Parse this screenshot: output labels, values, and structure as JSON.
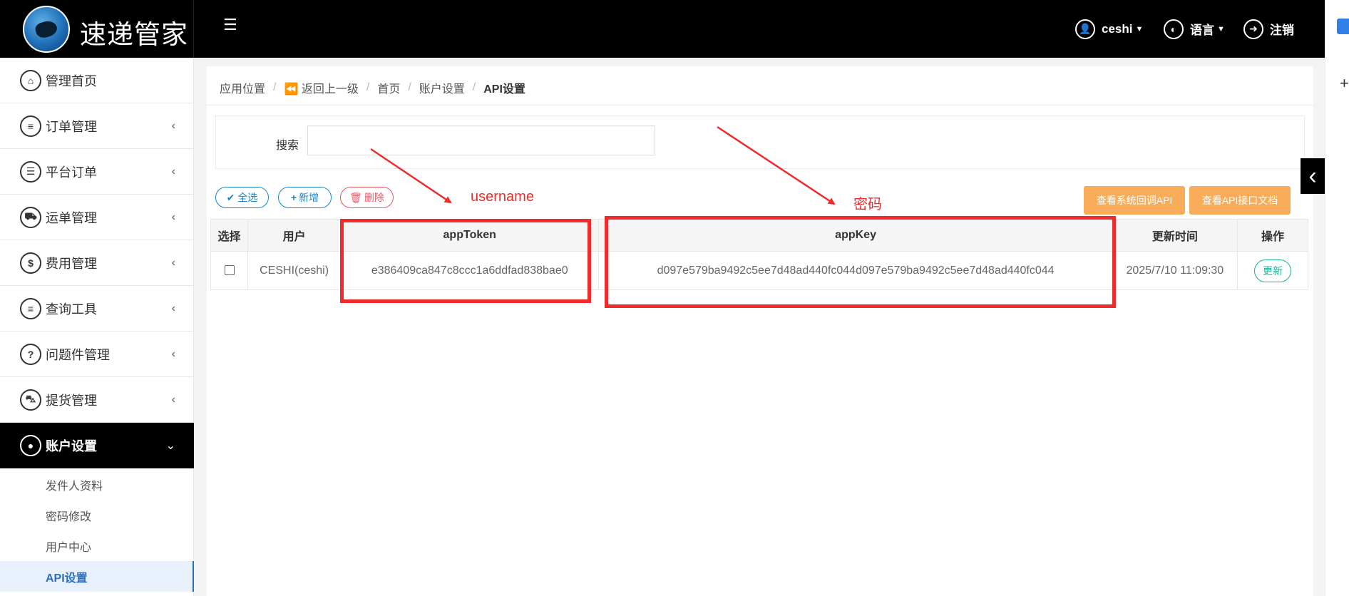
{
  "app": {
    "logo_text": "速递管家",
    "user_menu": "ceshi",
    "language_menu": "语言",
    "logout": "注销"
  },
  "sidebar": {
    "items": [
      {
        "label": "管理首页",
        "icon": "home-icon"
      },
      {
        "label": "订单管理",
        "icon": "document-icon"
      },
      {
        "label": "平台订单",
        "icon": "list-icon"
      },
      {
        "label": "运单管理",
        "icon": "truck-icon"
      },
      {
        "label": "费用管理",
        "icon": "dollar-icon"
      },
      {
        "label": "查询工具",
        "icon": "document-icon"
      },
      {
        "label": "问题件管理",
        "icon": "question-icon"
      },
      {
        "label": "提货管理",
        "icon": "cart-icon"
      },
      {
        "label": "账户设置",
        "icon": "user-icon"
      }
    ],
    "sub_items": [
      "发件人资料",
      "密码修改",
      "用户中心",
      "API设置"
    ]
  },
  "breadcrumb": {
    "location": "应用位置",
    "back": "返回上一级",
    "home": "首页",
    "account": "账户设置",
    "current": "API设置"
  },
  "search": {
    "label": "搜索",
    "value": "",
    "placeholder": ""
  },
  "toolbar": {
    "select_all": "全选",
    "add": "新增",
    "delete": "删除",
    "view_callback_api": "查看系统回调API",
    "view_api_docs": "查看API接口文档"
  },
  "table": {
    "headers": [
      "选择",
      "用户",
      "appToken",
      "appKey",
      "更新时间",
      "操作"
    ],
    "rows": [
      {
        "user": "CESHI(ceshi)",
        "app_token": "e386409ca847c8ccc1a6ddfad838bae0",
        "app_key": "d097e579ba9492c5ee7d48ad440fc044d097e579ba9492c5ee7d48ad440fc044",
        "updated": "2025/7/10 11:09:30",
        "action": "更新"
      }
    ]
  },
  "annotations": {
    "username": "username",
    "password": "密码"
  },
  "colors": {
    "annotation_red": "#ef2b2b",
    "select_all_blue": "#1c84c6",
    "delete_red": "#ed5565",
    "orange_button": "#f8ac59",
    "update_green": "#1ab394"
  }
}
